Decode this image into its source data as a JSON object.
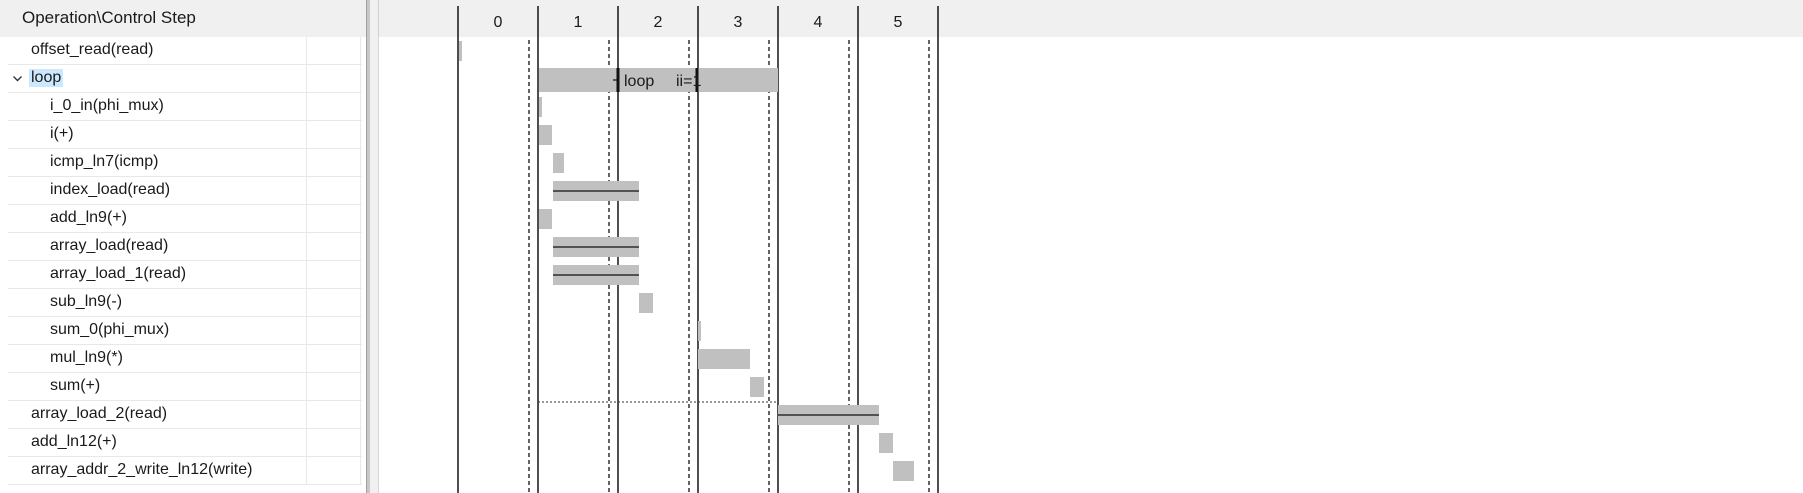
{
  "header": {
    "title": "Operation\\Control Step"
  },
  "operations": [
    {
      "label": "offset_read(read)",
      "level": 1
    },
    {
      "label": "loop",
      "level": 1,
      "expandable": true,
      "expanded": true,
      "selected": true
    },
    {
      "label": "i_0_in(phi_mux)",
      "level": 2
    },
    {
      "label": "i(+)",
      "level": 2
    },
    {
      "label": "icmp_ln7(icmp)",
      "level": 2
    },
    {
      "label": "index_load(read)",
      "level": 2
    },
    {
      "label": "add_ln9(+)",
      "level": 2
    },
    {
      "label": "array_load(read)",
      "level": 2
    },
    {
      "label": "array_load_1(read)",
      "level": 2
    },
    {
      "label": "sub_ln9(-)",
      "level": 2
    },
    {
      "label": "sum_0(phi_mux)",
      "level": 2
    },
    {
      "label": "mul_ln9(*)",
      "level": 2
    },
    {
      "label": "sum(+)",
      "level": 2
    },
    {
      "label": "array_load_2(read)",
      "level": 1
    },
    {
      "label": "add_ln12(+)",
      "level": 1
    },
    {
      "label": "array_addr_2_write_ln12(write)",
      "level": 1
    }
  ],
  "control_steps": [
    "0",
    "1",
    "2",
    "3",
    "4",
    "5"
  ],
  "loop_bar": {
    "label": "loop",
    "ii_label": "ii=1"
  },
  "colors": {
    "bar": "#c0c0c0",
    "selection": "#cce8ff",
    "header_bg": "#f0f0f0"
  },
  "icons": {
    "expand": "chevron-down-icon"
  }
}
